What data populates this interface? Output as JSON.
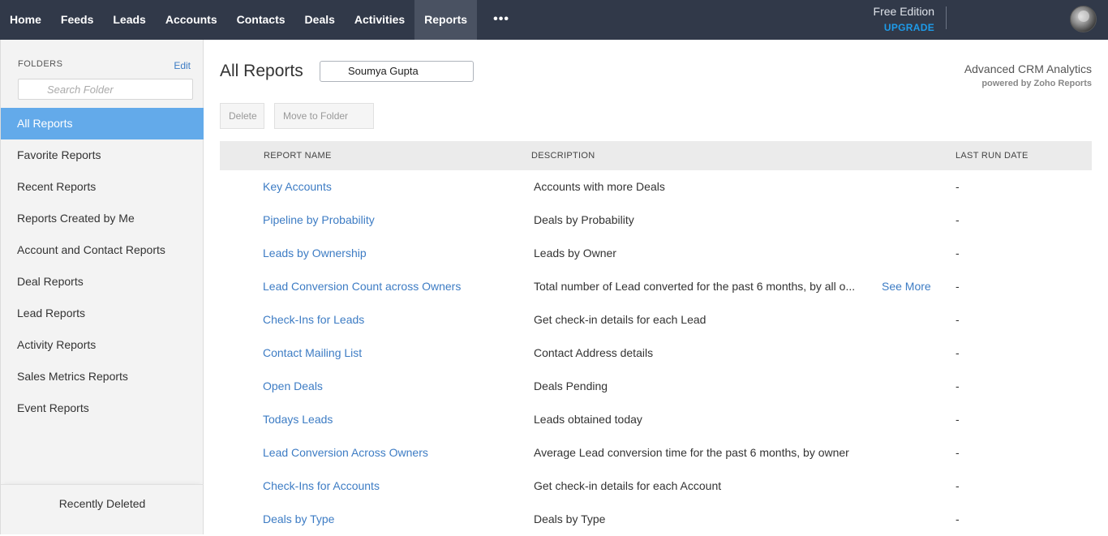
{
  "nav": {
    "items": [
      {
        "label": "Home",
        "active": false
      },
      {
        "label": "Feeds",
        "active": false
      },
      {
        "label": "Leads",
        "active": false
      },
      {
        "label": "Accounts",
        "active": false
      },
      {
        "label": "Contacts",
        "active": false
      },
      {
        "label": "Deals",
        "active": false
      },
      {
        "label": "Activities",
        "active": false
      },
      {
        "label": "Reports",
        "active": true
      }
    ],
    "more_label": "•••",
    "edition_label": "Free Edition",
    "upgrade_label": "UPGRADE"
  },
  "sidebar": {
    "folders_label": "FOLDERS",
    "edit_label": "Edit",
    "search_placeholder": "Search Folder",
    "items": [
      "All Reports",
      "Favorite Reports",
      "Recent Reports",
      "Reports Created by Me",
      "Account and Contact Reports",
      "Deal Reports",
      "Lead Reports",
      "Activity Reports",
      "Sales Metrics Reports",
      "Event Reports"
    ],
    "active_index": 0,
    "recently_deleted": "Recently Deleted"
  },
  "main": {
    "title": "All Reports",
    "user_filter": "Soumya Gupta",
    "analytics_title": "Advanced CRM Analytics",
    "analytics_sub": "powered by Zoho Reports",
    "delete_label": "Delete",
    "move_label": "Move to Folder"
  },
  "table": {
    "headers": {
      "name": "REPORT NAME",
      "description": "DESCRIPTION",
      "last_run": "LAST RUN DATE"
    },
    "rows": [
      {
        "name": "Key Accounts",
        "description": "Accounts with more Deals",
        "more": "",
        "last_run": "-"
      },
      {
        "name": "Pipeline by Probability",
        "description": "Deals by Probability",
        "more": "",
        "last_run": "-"
      },
      {
        "name": "Leads by Ownership",
        "description": "Leads by Owner",
        "more": "",
        "last_run": "-"
      },
      {
        "name": "Lead Conversion Count across Owners",
        "description": "Total number of Lead converted for the past 6 months, by all o...",
        "more": "See More",
        "last_run": "-"
      },
      {
        "name": "Check-Ins for Leads",
        "description": "Get check-in details for each Lead",
        "more": "",
        "last_run": "-"
      },
      {
        "name": "Contact Mailing List",
        "description": "Contact Address details",
        "more": "",
        "last_run": "-"
      },
      {
        "name": "Open Deals",
        "description": "Deals Pending",
        "more": "",
        "last_run": "-"
      },
      {
        "name": "Todays Leads",
        "description": "Leads obtained today",
        "more": "",
        "last_run": "-"
      },
      {
        "name": "Lead Conversion Across Owners",
        "description": "Average Lead conversion time for the past 6 months, by owner",
        "more": "",
        "last_run": "-"
      },
      {
        "name": "Check-Ins for Accounts",
        "description": "Get check-in details for each Account",
        "more": "",
        "last_run": "-"
      },
      {
        "name": "Deals by Type",
        "description": "Deals by Type",
        "more": "",
        "last_run": "-"
      }
    ]
  }
}
